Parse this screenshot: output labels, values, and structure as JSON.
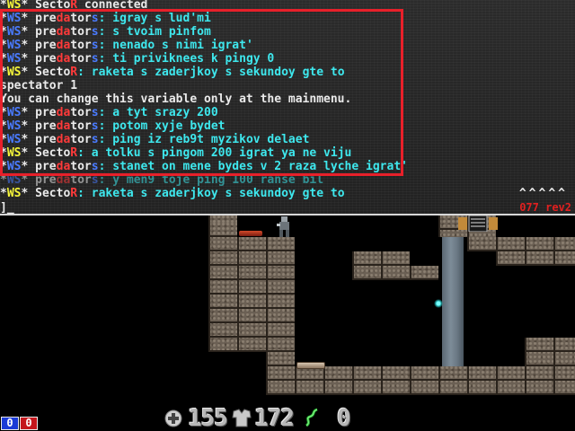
{
  "console": {
    "lines": [
      {
        "segments": [
          {
            "t": "*",
            "c": "white"
          },
          {
            "t": "WS",
            "c": "yellow"
          },
          {
            "t": "* Secto",
            "c": "white"
          },
          {
            "t": "R",
            "c": "red"
          },
          {
            "t": " connected",
            "c": "white"
          }
        ]
      },
      {
        "segments": [
          {
            "t": "*",
            "c": "white"
          },
          {
            "t": "WS",
            "c": "blue"
          },
          {
            "t": "* pre",
            "c": "white"
          },
          {
            "t": "da",
            "c": "red"
          },
          {
            "t": "tor",
            "c": "white"
          },
          {
            "t": "s",
            "c": "blue"
          },
          {
            "t": ": igray s lud'mi",
            "c": "cyan"
          }
        ]
      },
      {
        "segments": [
          {
            "t": "*",
            "c": "white"
          },
          {
            "t": "WS",
            "c": "blue"
          },
          {
            "t": "* pre",
            "c": "white"
          },
          {
            "t": "da",
            "c": "red"
          },
          {
            "t": "tor",
            "c": "white"
          },
          {
            "t": "s",
            "c": "blue"
          },
          {
            "t": ": s tvoim pinfom",
            "c": "cyan"
          }
        ]
      },
      {
        "segments": [
          {
            "t": "*",
            "c": "white"
          },
          {
            "t": "WS",
            "c": "blue"
          },
          {
            "t": "* pre",
            "c": "white"
          },
          {
            "t": "da",
            "c": "red"
          },
          {
            "t": "tor",
            "c": "white"
          },
          {
            "t": "s",
            "c": "blue"
          },
          {
            "t": ": nenado s nimi igrat'",
            "c": "cyan"
          }
        ]
      },
      {
        "segments": [
          {
            "t": "*",
            "c": "white"
          },
          {
            "t": "WS",
            "c": "blue"
          },
          {
            "t": "* pre",
            "c": "white"
          },
          {
            "t": "da",
            "c": "red"
          },
          {
            "t": "tor",
            "c": "white"
          },
          {
            "t": "s",
            "c": "blue"
          },
          {
            "t": ": ti priviknees k pingy 0",
            "c": "cyan"
          }
        ]
      },
      {
        "segments": [
          {
            "t": "*",
            "c": "white"
          },
          {
            "t": "WS",
            "c": "yellow"
          },
          {
            "t": "* Secto",
            "c": "white"
          },
          {
            "t": "R",
            "c": "red"
          },
          {
            "t": ": raketa s zaderjkoy s sekundoy gte to",
            "c": "cyan"
          }
        ]
      },
      {
        "segments": [
          {
            "t": "spectator 1",
            "c": "white"
          }
        ]
      },
      {
        "segments": [
          {
            "t": "You can change this variable only at the mainmenu.",
            "c": "white"
          }
        ]
      },
      {
        "segments": [
          {
            "t": "*",
            "c": "white"
          },
          {
            "t": "WS",
            "c": "blue"
          },
          {
            "t": "* pre",
            "c": "white"
          },
          {
            "t": "da",
            "c": "red"
          },
          {
            "t": "tor",
            "c": "white"
          },
          {
            "t": "s",
            "c": "blue"
          },
          {
            "t": ": a tyt srazy 200",
            "c": "cyan"
          }
        ]
      },
      {
        "segments": [
          {
            "t": "*",
            "c": "white"
          },
          {
            "t": "WS",
            "c": "blue"
          },
          {
            "t": "* pre",
            "c": "white"
          },
          {
            "t": "da",
            "c": "red"
          },
          {
            "t": "tor",
            "c": "white"
          },
          {
            "t": "s",
            "c": "blue"
          },
          {
            "t": ": potom xyje bydet",
            "c": "cyan"
          }
        ]
      },
      {
        "segments": [
          {
            "t": "*",
            "c": "white"
          },
          {
            "t": "WS",
            "c": "blue"
          },
          {
            "t": "* pre",
            "c": "white"
          },
          {
            "t": "da",
            "c": "red"
          },
          {
            "t": "tor",
            "c": "white"
          },
          {
            "t": "s",
            "c": "blue"
          },
          {
            "t": ": ping iz reb9t myzikov delaet",
            "c": "cyan"
          }
        ]
      },
      {
        "segments": [
          {
            "t": "*",
            "c": "white"
          },
          {
            "t": "WS",
            "c": "yellow"
          },
          {
            "t": "* Secto",
            "c": "white"
          },
          {
            "t": "R",
            "c": "red"
          },
          {
            "t": ": a tolku s pingom 200 igrat ya ne viju",
            "c": "cyan"
          }
        ]
      },
      {
        "segments": [
          {
            "t": "*",
            "c": "white"
          },
          {
            "t": "WS",
            "c": "blue"
          },
          {
            "t": "* pre",
            "c": "white"
          },
          {
            "t": "da",
            "c": "red"
          },
          {
            "t": "tor",
            "c": "white"
          },
          {
            "t": "s",
            "c": "blue"
          },
          {
            "t": ": stanet on mene bydes v 2 raza lyche igrat'",
            "c": "cyan"
          }
        ]
      },
      {
        "faded": true,
        "segments": [
          {
            "t": "*",
            "c": "white"
          },
          {
            "t": "WS",
            "c": "blue"
          },
          {
            "t": "* pre",
            "c": "white"
          },
          {
            "t": "da",
            "c": "red"
          },
          {
            "t": "tor",
            "c": "white"
          },
          {
            "t": "s",
            "c": "blue"
          },
          {
            "t": ": y men9 toje ping 100 ranse bil",
            "c": "cyan"
          }
        ]
      },
      {
        "segments": [
          {
            "t": "*",
            "c": "white"
          },
          {
            "t": "WS",
            "c": "yellow"
          },
          {
            "t": "* Secto",
            "c": "white"
          },
          {
            "t": "R",
            "c": "red"
          },
          {
            "t": ": raketa s zaderjkoy s sekundoy gte to",
            "c": "cyan"
          }
        ]
      }
    ],
    "prompt": "]_",
    "scroll_indicator": "^^^^^",
    "version": "077 rev2",
    "highlight_color": "#e8202a"
  },
  "hud": {
    "score_blue": "0",
    "score_red": "0",
    "health_icon": "health-cross-icon",
    "health": "155",
    "armor_icon": "armor-vest-icon",
    "armor": "172",
    "ammo_icon": "weapon-icon",
    "ammo": "0"
  },
  "colors": {
    "console_bg": "#262626",
    "yellow": "#f5f53a",
    "cyan": "#3ee8ee",
    "blue": "#4a7bff",
    "red": "#ff3a3a",
    "team_blue": "#1a3ad6",
    "team_red": "#c4161c"
  }
}
